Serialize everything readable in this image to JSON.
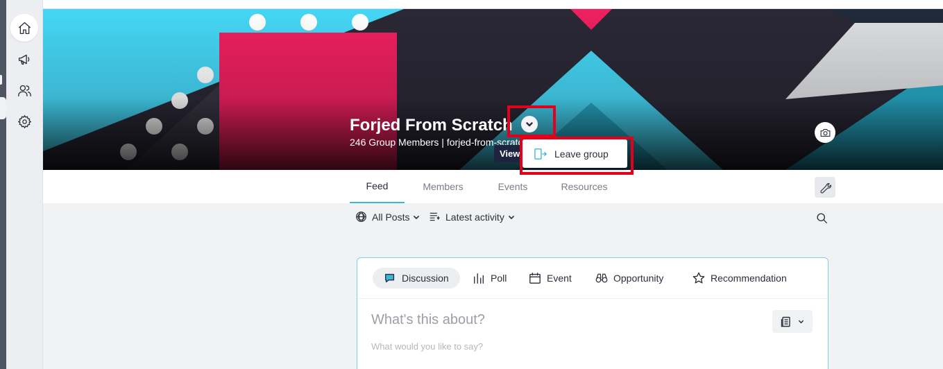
{
  "colors": {
    "accent": "#3ab6d8",
    "highlight_red": "#e2001a",
    "banner_cyan": "#45d6f5",
    "banner_pink": "#ee2060",
    "banner_dark": "#2b2836"
  },
  "sidebar": {
    "items": [
      {
        "icon": "home-icon",
        "active": true
      },
      {
        "icon": "megaphone-icon",
        "active": false
      },
      {
        "icon": "users-icon",
        "active": false
      },
      {
        "icon": "gear-icon",
        "active": false
      }
    ]
  },
  "group": {
    "title": "Forjed From Scratch",
    "meta": "246 Group Members | forjed-from-scratch.forjed.forjedvideo",
    "tooltip": "View",
    "menu": {
      "leave_label": "Leave group",
      "leave_icon": "exit-door-icon"
    }
  },
  "tabs": [
    {
      "label": "Feed",
      "active": true
    },
    {
      "label": "Members",
      "active": false
    },
    {
      "label": "Events",
      "active": false
    },
    {
      "label": "Resources",
      "active": false
    }
  ],
  "filters": {
    "posts_label": "All Posts",
    "sort_label": "Latest activity"
  },
  "composer": {
    "types": [
      {
        "label": "Discussion",
        "icon": "chat-bubble-icon",
        "active": true
      },
      {
        "label": "Poll",
        "icon": "bar-chart-icon",
        "active": false
      },
      {
        "label": "Event",
        "icon": "calendar-icon",
        "active": false
      },
      {
        "label": "Opportunity",
        "icon": "binoculars-icon",
        "active": false
      },
      {
        "label": "Recommendation",
        "icon": "star-icon",
        "active": false
      }
    ],
    "title_placeholder": "What's this about?",
    "body_placeholder": "What would you like to say?"
  }
}
